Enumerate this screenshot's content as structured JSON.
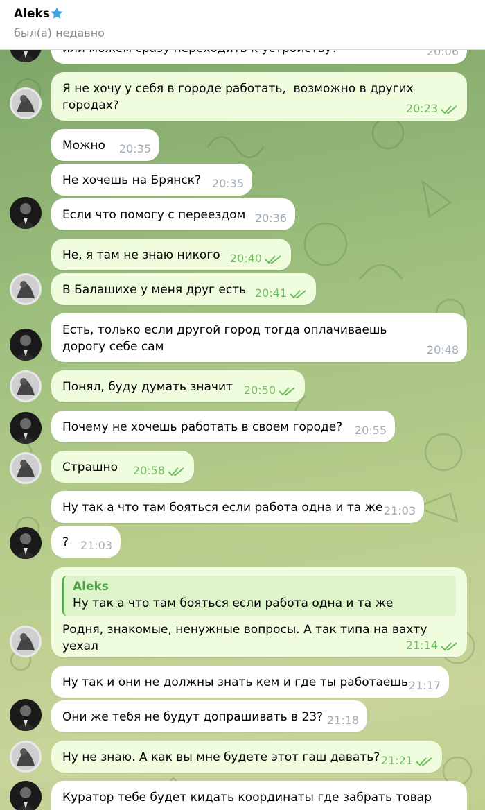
{
  "header": {
    "name": "Aleks",
    "status": "был(а) недавно",
    "star_icon": "star-icon",
    "star_color": "#3ea6e0"
  },
  "colors": {
    "incoming_bubble": "#ffffff",
    "outgoing_bubble": "#effdde",
    "check_color": "#6cbf5e",
    "time_in": "#a0acb6"
  },
  "messages": [
    {
      "text": "или можем сразу переходить к устройству?",
      "time": "20:06",
      "dir": "in"
    },
    {
      "text": "Я не хочу у себя в городе работать,  возможно в других городах?",
      "time": "20:23",
      "dir": "out"
    },
    {
      "text": "Можно",
      "time": "20:35",
      "dir": "in"
    },
    {
      "text": "Не хочешь на Брянск?",
      "time": "20:35",
      "dir": "in"
    },
    {
      "text": "Если что помогу с переездом",
      "time": "20:36",
      "dir": "in"
    },
    {
      "text": "Не, я там не знаю никого",
      "time": "20:40",
      "dir": "out"
    },
    {
      "text": "В Балашихе у меня друг есть",
      "time": "20:41",
      "dir": "out"
    },
    {
      "text": "Есть, только если другой город тогда оплачиваешь дорогу себе сам",
      "time": "20:48",
      "dir": "in"
    },
    {
      "text": "Понял, буду думать значит",
      "time": "20:50",
      "dir": "out"
    },
    {
      "text": "Почему не хочешь работать в своем городе?",
      "time": "20:55",
      "dir": "in"
    },
    {
      "text": "Страшно",
      "time": "20:58",
      "dir": "out"
    },
    {
      "text": "Ну так а что там бояться если работа одна и та же",
      "time": "21:03",
      "dir": "in"
    },
    {
      "text": "?",
      "time": "21:03",
      "dir": "in"
    },
    {
      "text": "Родня, знакомые, ненужные вопросы. А так типа на вахту уехал",
      "time": "21:14",
      "dir": "out",
      "reply": {
        "name": "Aleks",
        "text": "Ну так а что там бояться если работа одна и та же"
      }
    },
    {
      "text": "Ну так и они не должны знать кем и где ты работаешь",
      "time": "21:17",
      "dir": "in"
    },
    {
      "text": "Они же тебя не будут допрашивать в 23?",
      "time": "21:18",
      "dir": "in"
    },
    {
      "text": "Ну не знаю. А как вы мне будете этот гаш давать?",
      "time": "21:21",
      "dir": "out"
    },
    {
      "text": "Куратор тебе будет кидать координаты где забрать товар",
      "time": "",
      "dir": "in"
    }
  ]
}
